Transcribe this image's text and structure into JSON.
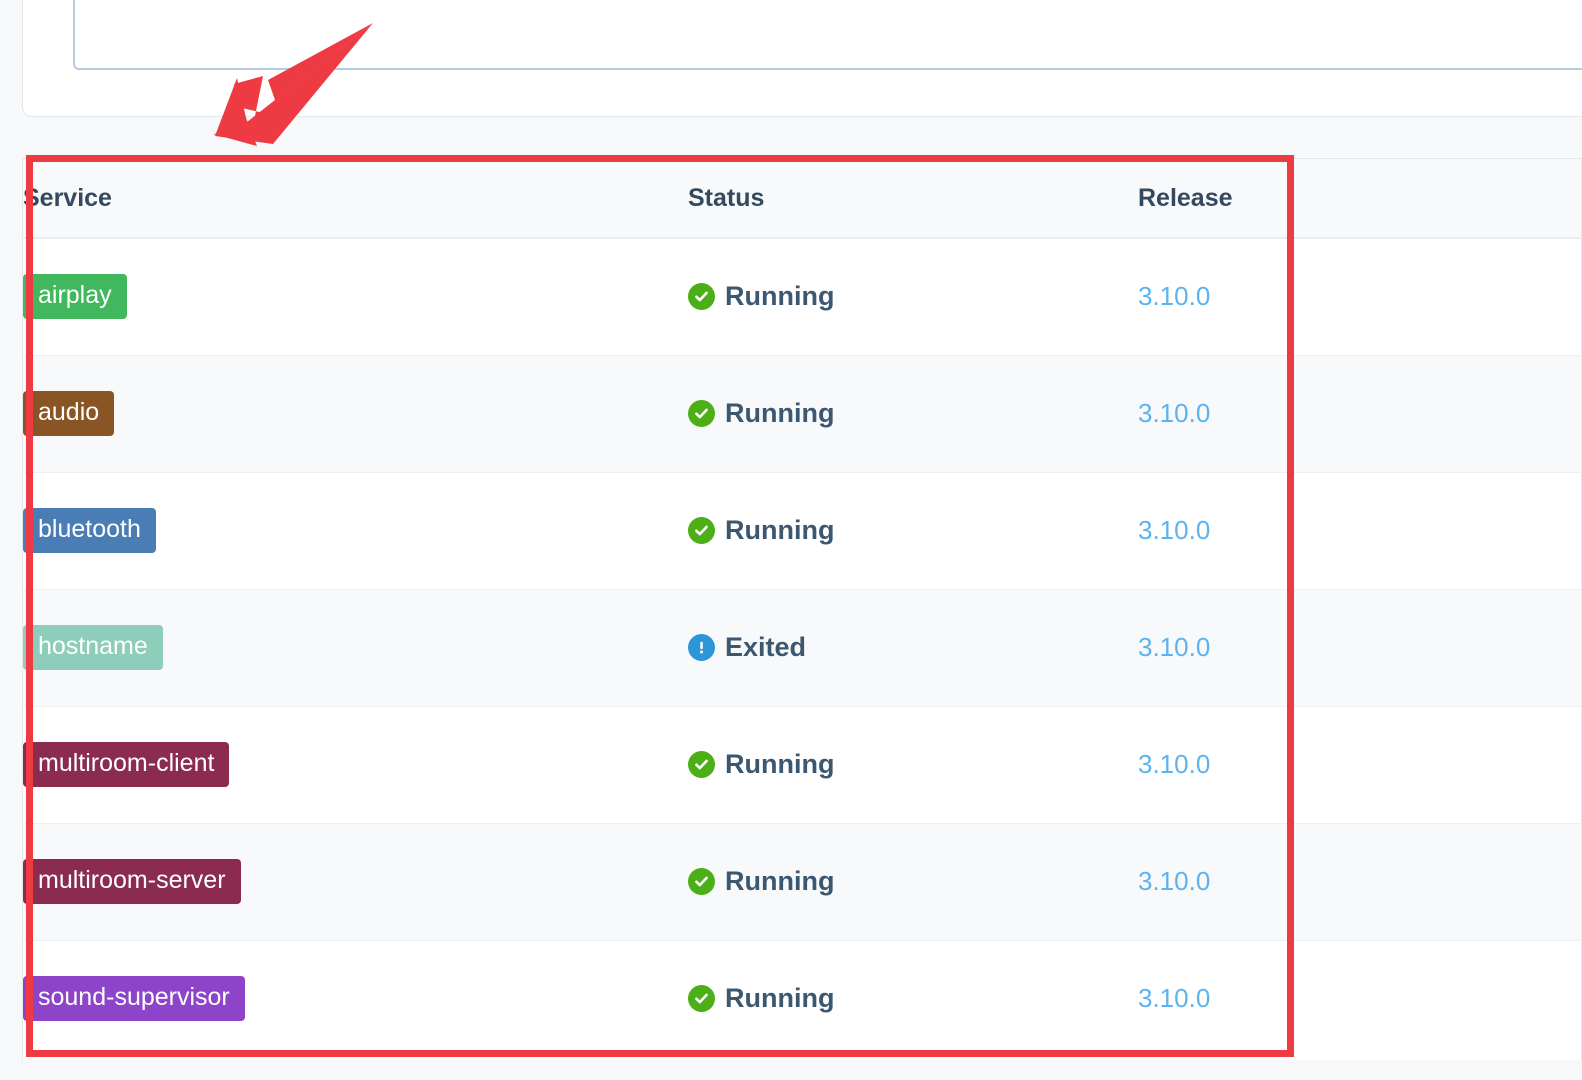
{
  "table": {
    "columns": [
      "Service",
      "Status",
      "Release"
    ],
    "rows": [
      {
        "service": "airplay",
        "badge_color": "#41b75e",
        "status": "Running",
        "status_kind": "running",
        "release": "3.10.0"
      },
      {
        "service": "audio",
        "badge_color": "#8a5524",
        "status": "Running",
        "status_kind": "running",
        "release": "3.10.0"
      },
      {
        "service": "bluetooth",
        "badge_color": "#4a7db5",
        "status": "Running",
        "status_kind": "running",
        "release": "3.10.0"
      },
      {
        "service": "hostname",
        "badge_color": "#8ecdb9",
        "status": "Exited",
        "status_kind": "exited",
        "release": "3.10.0"
      },
      {
        "service": "multiroom-client",
        "badge_color": "#8b2b50",
        "status": "Running",
        "status_kind": "running",
        "release": "3.10.0"
      },
      {
        "service": "multiroom-server",
        "badge_color": "#8b2b50",
        "status": "Running",
        "status_kind": "running",
        "release": "3.10.0"
      },
      {
        "service": "sound-supervisor",
        "badge_color": "#8e44c8",
        "status": "Running",
        "status_kind": "running",
        "release": "3.10.0"
      }
    ]
  },
  "status_styles": {
    "running": {
      "icon": "check-circle-icon",
      "color": "#4caf17"
    },
    "exited": {
      "icon": "exclamation-circle-icon",
      "color": "#2e95d8"
    }
  },
  "annotation": {
    "highlight_color": "#ee3a42",
    "arrow_icon": "arrow-down-left-icon",
    "rect_icon": "highlight-rectangle"
  }
}
